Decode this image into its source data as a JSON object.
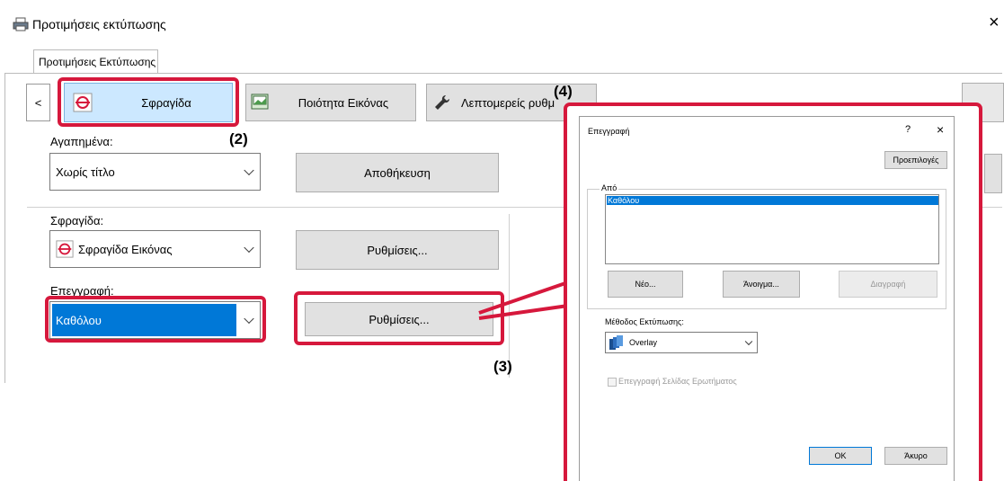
{
  "window": {
    "title": "Προτιμήσεις εκτύπωσης",
    "close_glyph": "×"
  },
  "tab": {
    "label": "Προτιμήσεις Εκτύπωσης"
  },
  "toolbar": {
    "back_glyph": "<",
    "stamp_tab": "Σφραγίδα",
    "image_quality_tab": "Ποιότητα Εικόνας",
    "details_tab": "Λεπτομερείς ρυθμ"
  },
  "favorites": {
    "label": "Αγαπημένα:",
    "value": "Χωρίς τίτλο",
    "save_button": "Αποθήκευση"
  },
  "stamp": {
    "label": "Σφραγίδα:",
    "value": "Σφραγίδα Εικόνας",
    "settings_button": "Ρυθμίσεις..."
  },
  "overlay": {
    "label": "Επεγγραφή:",
    "value": "Καθόλου",
    "settings_button": "Ρυθμίσεις..."
  },
  "callouts": {
    "step2": "(2)",
    "step3": "(3)",
    "step4": "(4)"
  },
  "dialog": {
    "title": "Επεγγραφή",
    "help_glyph": "?",
    "close_glyph": "×",
    "defaults_button": "Προεπιλογές",
    "from_label": "Από",
    "list_items": [
      "Καθόλου"
    ],
    "new_button": "Νέο...",
    "open_button": "Άνοιγμα...",
    "delete_button": "Διαγραφή",
    "method_label": "Μέθοδος Εκτύπωσης:",
    "method_value": "Overlay",
    "query_page_checkbox": "Επεγγραφή Σελίδας Ερωτήματος",
    "ok_button": "OK",
    "cancel_button": "Άκυρο"
  },
  "colors": {
    "accent_red": "#d6183c",
    "selection_blue": "#0078d7",
    "stamp_tab_bg": "#cce8ff"
  }
}
